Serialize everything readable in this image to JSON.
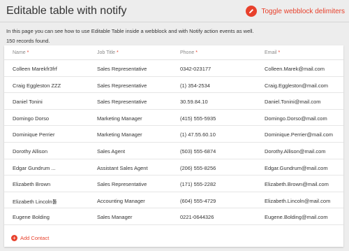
{
  "header": {
    "title": "Editable table with notify",
    "toggle_label": "Toggle webblock delimiters",
    "toggle_icon": "pencil-icon",
    "accent": "#e8412c"
  },
  "intro": "In this page you can see how to use Editable Table inside a webblock and with Notify action events as well.",
  "record_count": "150 records found.",
  "table": {
    "columns": [
      "Name",
      "Job Title",
      "Phone",
      "Email"
    ],
    "required_marker": "*",
    "rows": [
      [
        "Colleen Marekfr3frf",
        "Sales Representative",
        "0342-023177",
        "Colleen.Marek@mail.com"
      ],
      [
        "Craig Eggleston ZZZ",
        "Sales Representative",
        "(1) 354-2534",
        "Craig.Eggleston@mail.com"
      ],
      [
        "Daniel Tonini",
        "Sales Representative",
        "30.59.84.10",
        "Daniel.Tonini@mail.com"
      ],
      [
        "Domingo Dorso",
        "Marketing Manager",
        "(415) 555-5935",
        "Domingo.Dorso@mail.com"
      ],
      [
        "Dominique Perrier",
        "Marketing Manager",
        "(1) 47.55.60.10",
        "Dominique.Perrier@mail.com"
      ],
      [
        "Dorothy Allison",
        "Sales Agent",
        "(503) 555-6874",
        "Dorothy.Allison@mail.com"
      ],
      [
        "Edgar Gundrum ...",
        "Assistant Sales Agent",
        "(206) 555-8256",
        "Edgar.Gundrum@mail.com"
      ],
      [
        "Elizabeth Brown",
        "Sales Representative",
        "(171) 555-2282",
        "Elizabeth.Brown@mail.com"
      ],
      [
        "Elizabeth Lincoln툴",
        "Accounting Manager",
        "(604) 555-4729",
        "Elizabeth.Lincoln@mail.com"
      ],
      [
        "Eugene Bolding",
        "Sales Manager",
        "0221-0644326",
        "Eugene.Bolding@mail.com"
      ]
    ]
  },
  "add_contact": {
    "label": "Add Contact",
    "icon": "plus-circle-icon"
  }
}
